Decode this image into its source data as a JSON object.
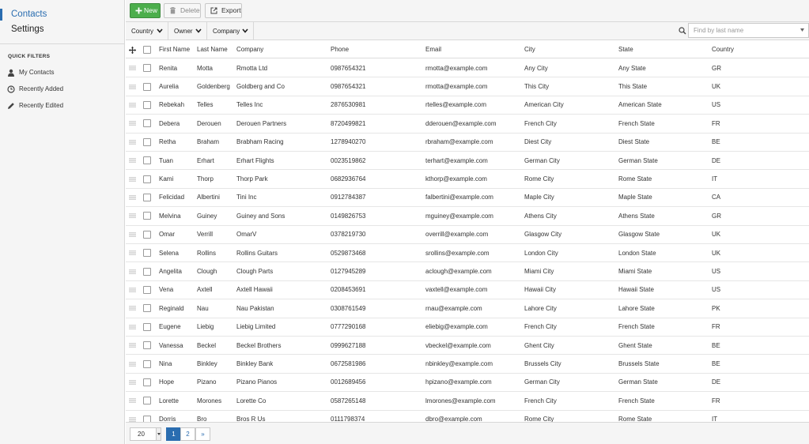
{
  "sidebar": {
    "nav": [
      {
        "label": "Contacts",
        "active": true
      },
      {
        "label": "Settings",
        "active": false
      }
    ],
    "quick_filters": {
      "heading": "QUICK FILTERS",
      "items": [
        {
          "label": "My Contacts",
          "icon": "user-icon"
        },
        {
          "label": "Recently Added",
          "icon": "clock-icon"
        },
        {
          "label": "Recently Edited",
          "icon": "pencil-icon"
        }
      ]
    }
  },
  "toolbar": {
    "new_label": "New",
    "delete_label": "Delete",
    "export_label": "Export"
  },
  "filters": {
    "country_label": "Country",
    "owner_label": "Owner",
    "company_label": "Company",
    "search_placeholder": "Find by last name"
  },
  "grid": {
    "columns": [
      "First Name",
      "Last Name",
      "Company",
      "Phone",
      "Email",
      "City",
      "State",
      "Country"
    ],
    "rows": [
      [
        "Renita",
        "Motta",
        "Rmotta Ltd",
        "0987654321",
        "rmotta@example.com",
        "Any City",
        "Any State",
        "GR"
      ],
      [
        "Aurelia",
        "Goldenberg",
        "Goldberg and Co",
        "0987654321",
        "rmotta@example.com",
        "This City",
        "This State",
        "UK"
      ],
      [
        "Rebekah",
        "Telles",
        "Telles Inc",
        "2876530981",
        "rtelles@example.com",
        "American City",
        "American State",
        "US"
      ],
      [
        "Debera",
        "Derouen",
        "Derouen Partners",
        "8720499821",
        "dderouen@example.com",
        "French City",
        "French State",
        "FR"
      ],
      [
        "Retha",
        "Braham",
        "Brabham Racing",
        "1278940270",
        "rbraham@example.com",
        "Diest City",
        "Diest State",
        "BE"
      ],
      [
        "Tuan",
        "Erhart",
        "Erhart Flights",
        "0023519862",
        "terhart@example.com",
        "German City",
        "German State",
        "DE"
      ],
      [
        "Kami",
        "Thorp",
        "Thorp Park",
        "0682936764",
        "kthorp@example.com",
        "Rome City",
        "Rome State",
        "IT"
      ],
      [
        "Felicidad",
        "Albertini",
        "Tini Inc",
        "0912784387",
        "falbertini@example.com",
        "Maple City",
        "Maple State",
        "CA"
      ],
      [
        "Melvina",
        "Guiney",
        "Guiney and Sons",
        "0149826753",
        "mguiney@example.com",
        "Athens City",
        "Athens State",
        "GR"
      ],
      [
        "Omar",
        "Verrill",
        "OmarV",
        "0378219730",
        "overrill@example.com",
        "Glasgow City",
        "Glasgow State",
        "UK"
      ],
      [
        "Selena",
        "Rollins",
        "Rollins Guitars",
        "0529873468",
        "srollins@example.com",
        "London City",
        "London State",
        "UK"
      ],
      [
        "Angelita",
        "Clough",
        "Clough Parts",
        "0127945289",
        "aclough@example.com",
        "Miami City",
        "Miami State",
        "US"
      ],
      [
        "Vena",
        "Axtell",
        "Axtell Hawaii",
        "0208453691",
        "vaxtell@example.com",
        "Hawaii City",
        "Hawaii State",
        "US"
      ],
      [
        "Reginald",
        "Nau",
        "Nau Pakistan",
        "0308761549",
        "rnau@example.com",
        "Lahore City",
        "Lahore State",
        "PK"
      ],
      [
        "Eugene",
        "Liebig",
        "Liebig Limited",
        "0777290168",
        "eliebig@example.com",
        "French City",
        "French State",
        "FR"
      ],
      [
        "Vanessa",
        "Beckel",
        "Beckel Brothers",
        "0999627188",
        "vbeckel@example.com",
        "Ghent City",
        "Ghent State",
        "BE"
      ],
      [
        "Nina",
        "Binkley",
        "Binkley Bank",
        "0672581986",
        "nbinkley@example.com",
        "Brussels City",
        "Brussels State",
        "BE"
      ],
      [
        "Hope",
        "Pizano",
        "Pizano Pianos",
        "0012689456",
        "hpizano@example.com",
        "German City",
        "German State",
        "DE"
      ],
      [
        "Lorette",
        "Morones",
        "Lorette Co",
        "0587265148",
        "lmorones@example.com",
        "French City",
        "French State",
        "FR"
      ],
      [
        "Dorris",
        "Bro",
        "Bros R Us",
        "0111798374",
        "dbro@example.com",
        "Rome City",
        "Rome State",
        "IT"
      ]
    ]
  },
  "pager": {
    "page_size": "20",
    "pages": [
      "1",
      "2"
    ],
    "current_page": "1",
    "next_label": "»"
  },
  "colors": {
    "accent": "#2a6db0",
    "new_button": "#4cae4c"
  }
}
